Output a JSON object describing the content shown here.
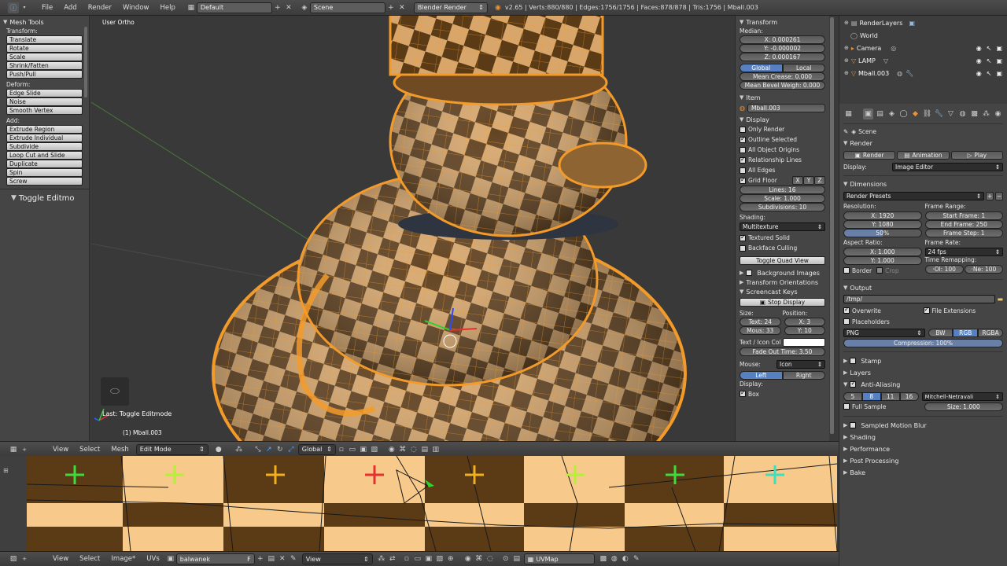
{
  "topbar": {
    "menus": [
      "File",
      "Add",
      "Render",
      "Window",
      "Help"
    ],
    "screen": "Default",
    "scene": "Scene",
    "engine": "Blender Render",
    "stats": "v2.65 | Verts:880/880 | Edges:1756/1756 | Faces:878/878 | Tris:1756 | Mball.003"
  },
  "toolshelf": {
    "title": "Mesh Tools",
    "transform_label": "Transform:",
    "transform": [
      "Translate",
      "Rotate",
      "Scale",
      "Shrink/Fatten",
      "Push/Pull"
    ],
    "deform_label": "Deform:",
    "deform": [
      "Edge Slide",
      "Noise",
      "Smooth Vertex"
    ],
    "add_label": "Add:",
    "add": [
      "Extrude Region",
      "Extrude Individual",
      "Subdivide",
      "Loop Cut and Slide",
      "Duplicate",
      "Spin",
      "Screw"
    ],
    "operator": "Toggle Editmo"
  },
  "viewport": {
    "view_name": "User Ortho",
    "last_op": "Last: Toggle Editmode",
    "object_label": "(1) Mball.003",
    "header": {
      "items": [
        "View",
        "Select",
        "Mesh"
      ],
      "mode": "Edit Mode",
      "orientation": "Global"
    }
  },
  "npanel": {
    "transform": {
      "title": "Transform",
      "median": "Median:",
      "x": "X: 0.000261",
      "y": "Y: -0.000002",
      "z": "Z: 0.000167",
      "global": "Global",
      "local": "Local",
      "crease": "Mean Crease: 0.000",
      "bevel": "Mean Bevel Weigh: 0.000"
    },
    "item": {
      "title": "Item",
      "name": "Mball.003"
    },
    "display": {
      "title": "Display",
      "only_render": "Only Render",
      "outline": "Outline Selected",
      "origins": "All Object Origins",
      "relationship": "Relationship Lines",
      "all_edges": "All Edges",
      "grid_floor": "Grid Floor",
      "gx": "X",
      "gy": "Y",
      "gz": "Z",
      "lines": "Lines: 16",
      "scale": "Scale: 1.000",
      "subdiv": "Subdivisions: 10",
      "shading": "Shading:",
      "shading_val": "Multitexture",
      "textured": "Textured Solid",
      "backface": "Backface Culling",
      "quad": "Toggle Quad View"
    },
    "bg": "Background Images",
    "orient": "Transform Orientations",
    "screencast": {
      "title": "Screencast Keys",
      "stop": "Stop Display",
      "size": "Size:",
      "position": "Position:",
      "text": "Text: 24",
      "mouse": "Mous: 33",
      "x": "X: 3",
      "y": "Y: 10",
      "icon_col": "Text / Icon Col",
      "fade": "Fade Out Time: 3.50",
      "mouse_label": "Mouse:",
      "mouse_val": "Icon",
      "left": "Left",
      "right": "Right",
      "display_label": "Display:",
      "box": "Box"
    }
  },
  "outliner": {
    "items": [
      {
        "name": "RenderLayers"
      },
      {
        "name": "World"
      },
      {
        "name": "Camera"
      },
      {
        "name": "LAMP"
      },
      {
        "name": "Mball.003"
      }
    ]
  },
  "properties": {
    "breadcrumb": "Scene",
    "render": {
      "title": "Render",
      "render_btn": "Render",
      "anim_btn": "Animation",
      "play_btn": "Play",
      "display_label": "Display:",
      "display_val": "Image Editor"
    },
    "dimensions": {
      "title": "Dimensions",
      "presets": "Render Presets",
      "resolution": "Resolution:",
      "rx": "X: 1920",
      "ry": "Y: 1080",
      "pct": "50%",
      "frame_range": "Frame Range:",
      "start": "Start Frame: 1",
      "end": "End Frame: 250",
      "step": "Frame Step: 1",
      "aspect": "Aspect Ratio:",
      "ax": "X: 1.000",
      "ay": "Y: 1.000",
      "frame_rate": "Frame Rate:",
      "fps": "24 fps",
      "remap": "Time Remapping:",
      "old": "·Ol: 100",
      "new": "·Ne: 100",
      "border": "Border",
      "crop": "Crop"
    },
    "output": {
      "title": "Output",
      "path": "/tmp/",
      "overwrite": "Overwrite",
      "file_ext": "File Extensions",
      "placeholders": "Placeholders",
      "format": "PNG",
      "bw": "BW",
      "rgb": "RGB",
      "rgba": "RGBA",
      "compression": "Compression: 100%"
    },
    "stamp": "Stamp",
    "layers": "Layers",
    "aa": {
      "title": "Anti-Aliasing",
      "levels": [
        "5",
        "8",
        "11",
        "16"
      ],
      "filter": "Mitchell-Netravali",
      "full": "Full Sample",
      "size": "Size: 1.000"
    },
    "collapsed": [
      "Sampled Motion Blur",
      "Shading",
      "Performance",
      "Post Processing",
      "Bake"
    ]
  },
  "uv": {
    "header": {
      "view": "View",
      "select": "Select",
      "image": "Image*",
      "uvs": "UVs",
      "image_name": "balwanek",
      "f": "F",
      "view_mode": "View",
      "uvmap": "UVMap"
    }
  }
}
